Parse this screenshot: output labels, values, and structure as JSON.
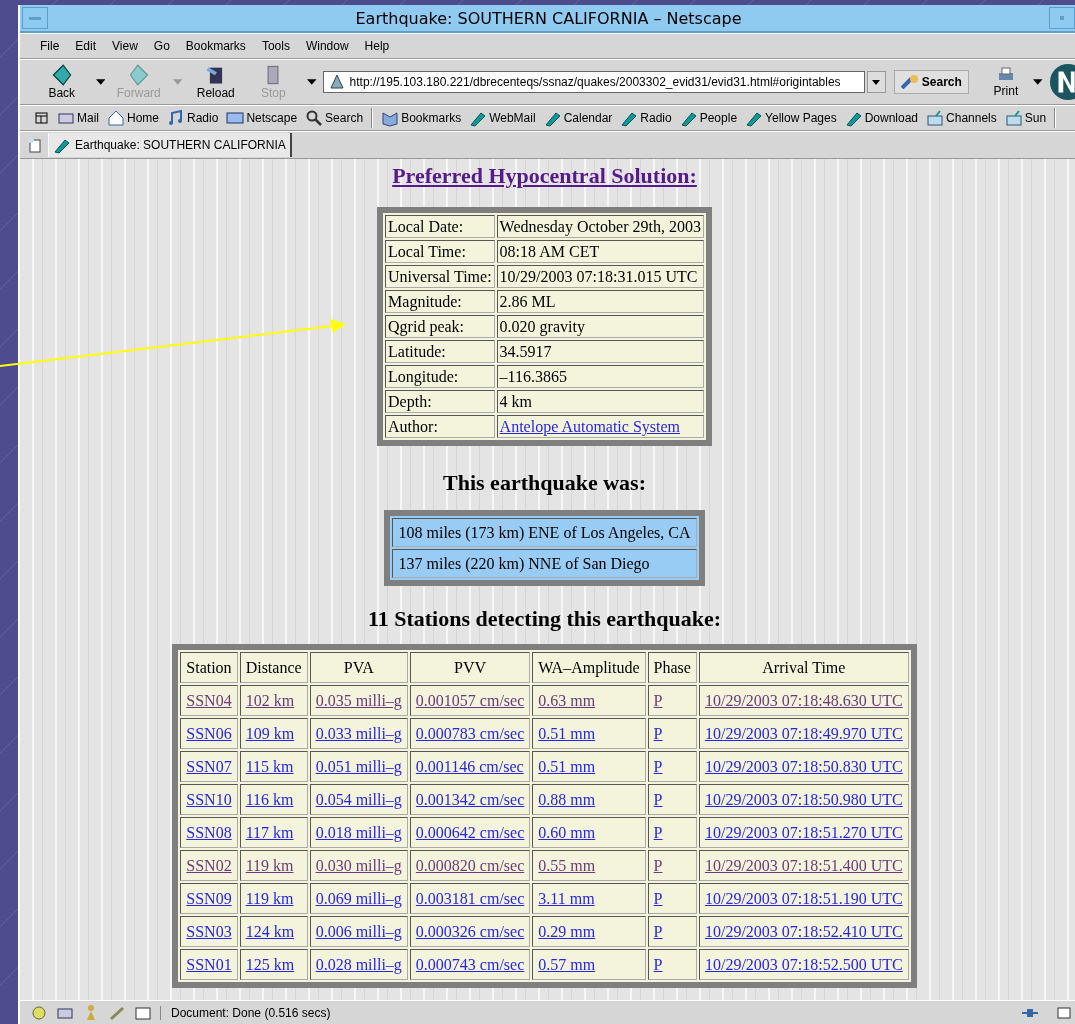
{
  "window": {
    "title": "Earthquake: SOUTHERN CALIFORNIA – Netscape"
  },
  "menu": [
    "File",
    "Edit",
    "View",
    "Go",
    "Bookmarks",
    "Tools",
    "Window",
    "Help"
  ],
  "nav_buttons": [
    {
      "label": "Back",
      "kind": "back",
      "disabled": false,
      "caret": true
    },
    {
      "label": "Forward",
      "kind": "forward",
      "disabled": true,
      "caret": true
    },
    {
      "label": "Reload",
      "kind": "reload",
      "disabled": false,
      "caret": false
    },
    {
      "label": "Stop",
      "kind": "stop",
      "disabled": true,
      "caret": true
    }
  ],
  "address": {
    "value": "http://195.103.180.221/dbrecenteqs/ssnaz/quakes/2003302_evid31/evid31.html#origintables"
  },
  "search_button": "Search",
  "print_button": "Print",
  "personal_toolbar": [
    {
      "label": "Mail",
      "kind": "mail"
    },
    {
      "label": "Home",
      "kind": "home"
    },
    {
      "label": "Radio",
      "kind": "music"
    },
    {
      "label": "Netscape",
      "kind": "my"
    },
    {
      "label": "Search",
      "kind": "search"
    },
    {
      "label": "Bookmarks",
      "kind": "bookmarks"
    },
    {
      "label": "WebMail",
      "kind": "link"
    },
    {
      "label": "Calendar",
      "kind": "link"
    },
    {
      "label": "Radio",
      "kind": "link"
    },
    {
      "label": "People",
      "kind": "link"
    },
    {
      "label": "Yellow Pages",
      "kind": "link"
    },
    {
      "label": "Download",
      "kind": "link"
    },
    {
      "label": "Channels",
      "kind": "folder"
    },
    {
      "label": "Sun",
      "kind": "folder"
    }
  ],
  "tabs": [
    {
      "label": "Earthquake: SOUTHERN CALIFORNIA",
      "selected": true
    }
  ],
  "page": {
    "heading": "Preferred Hypocentral Solution:",
    "details": [
      {
        "label": "Local Date:",
        "value": "Wednesday October 29th, 2003",
        "kind": "text"
      },
      {
        "label": "Local Time:",
        "value": "08:18 AM CET",
        "kind": "text"
      },
      {
        "label": "Universal Time:",
        "value": "10/29/2003 07:18:31.015 UTC",
        "kind": "text"
      },
      {
        "label": "Magnitude:",
        "value": "2.86 ML",
        "kind": "text"
      },
      {
        "label": "Qgrid peak:",
        "value": "0.020 gravity",
        "kind": "text"
      },
      {
        "label": "Latitude:",
        "value": "34.5917",
        "kind": "text"
      },
      {
        "label": "Longitude:",
        "value": "–116.3865",
        "kind": "text"
      },
      {
        "label": "Depth:",
        "value": "4 km",
        "kind": "text"
      },
      {
        "label": "Author:",
        "value": "Antelope Automatic System",
        "kind": "link"
      }
    ],
    "location_heading": "This earthquake was:",
    "locations": [
      "108 miles (173 km) ENE of Los Angeles, CA",
      "137 miles (220 km) NNE of San Diego"
    ],
    "stations_heading": "11 Stations detecting this earthquake:",
    "stations": {
      "columns": [
        "Station",
        "Distance",
        "PVA",
        "PVV",
        "WA–Amplitude",
        "Phase",
        "Arrival Time"
      ],
      "rows": [
        {
          "visited": true,
          "cells": [
            "SSN04",
            "102 km",
            "0.035 milli–g",
            "0.001057 cm/sec",
            "0.63 mm",
            "P",
            "10/29/2003 07:18:48.630 UTC"
          ]
        },
        {
          "visited": false,
          "cells": [
            "SSN06",
            "109 km",
            "0.033 milli–g",
            "0.000783 cm/sec",
            "0.51 mm",
            "P",
            "10/29/2003 07:18:49.970 UTC"
          ]
        },
        {
          "visited": false,
          "cells": [
            "SSN07",
            "115 km",
            "0.051 milli–g",
            "0.001146 cm/sec",
            "0.51 mm",
            "P",
            "10/29/2003 07:18:50.830 UTC"
          ]
        },
        {
          "visited": false,
          "cells": [
            "SSN10",
            "116 km",
            "0.054 milli–g",
            "0.001342 cm/sec",
            "0.88 mm",
            "P",
            "10/29/2003 07:18:50.980 UTC"
          ]
        },
        {
          "visited": false,
          "cells": [
            "SSN08",
            "117 km",
            "0.018 milli–g",
            "0.000642 cm/sec",
            "0.60 mm",
            "P",
            "10/29/2003 07:18:51.270 UTC"
          ]
        },
        {
          "visited": true,
          "cells": [
            "SSN02",
            "119 km",
            "0.030 milli–g",
            "0.000820 cm/sec",
            "0.55 mm",
            "P",
            "10/29/2003 07:18:51.400 UTC"
          ]
        },
        {
          "visited": false,
          "cells": [
            "SSN09",
            "119 km",
            "0.069 milli–g",
            "0.003181 cm/sec",
            "3.11 mm",
            "P",
            "10/29/2003 07:18:51.190 UTC"
          ]
        },
        {
          "visited": false,
          "cells": [
            "SSN03",
            "124 km",
            "0.006 milli–g",
            "0.000326 cm/sec",
            "0.29 mm",
            "P",
            "10/29/2003 07:18:52.410 UTC"
          ]
        },
        {
          "visited": false,
          "cells": [
            "SSN01",
            "125 km",
            "0.028 milli–g",
            "0.000743 cm/sec",
            "0.57 mm",
            "P",
            "10/29/2003 07:18:52.500 UTC"
          ]
        }
      ]
    }
  },
  "status_bar": {
    "text": "Document: Done (0.516 secs)"
  }
}
